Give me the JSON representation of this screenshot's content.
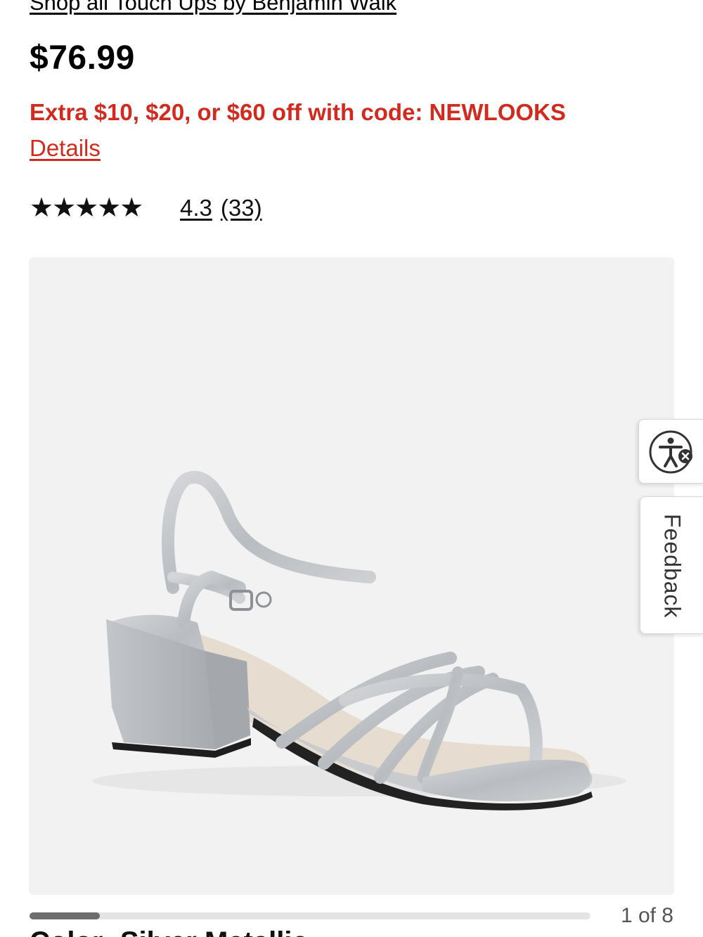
{
  "product": {
    "brand_link": "Shop all Touch Ups by Benjamin Walk",
    "price": "$76.99",
    "promo_text": "Extra $10, $20, or $60 off with code: NEWLOOKS",
    "details_link": "Details",
    "rating": {
      "stars_value": 4.3,
      "stars_max": 5,
      "value_text": "4.3",
      "count_text": "(33)"
    },
    "image": {
      "icon": "silver-metallic-block-heel-sandal",
      "background": "#f2f2f2"
    },
    "gallery": {
      "current": 1,
      "total": 8,
      "counter_text": "1 of 8"
    },
    "color_label_partial": "Color: Silver Metallic"
  },
  "widgets": {
    "accessibility_icon": "accessibility-icon",
    "feedback_label": "Feedback"
  },
  "colors": {
    "promo": "#d12b1f",
    "price": "#000000",
    "stars": "#111111"
  }
}
